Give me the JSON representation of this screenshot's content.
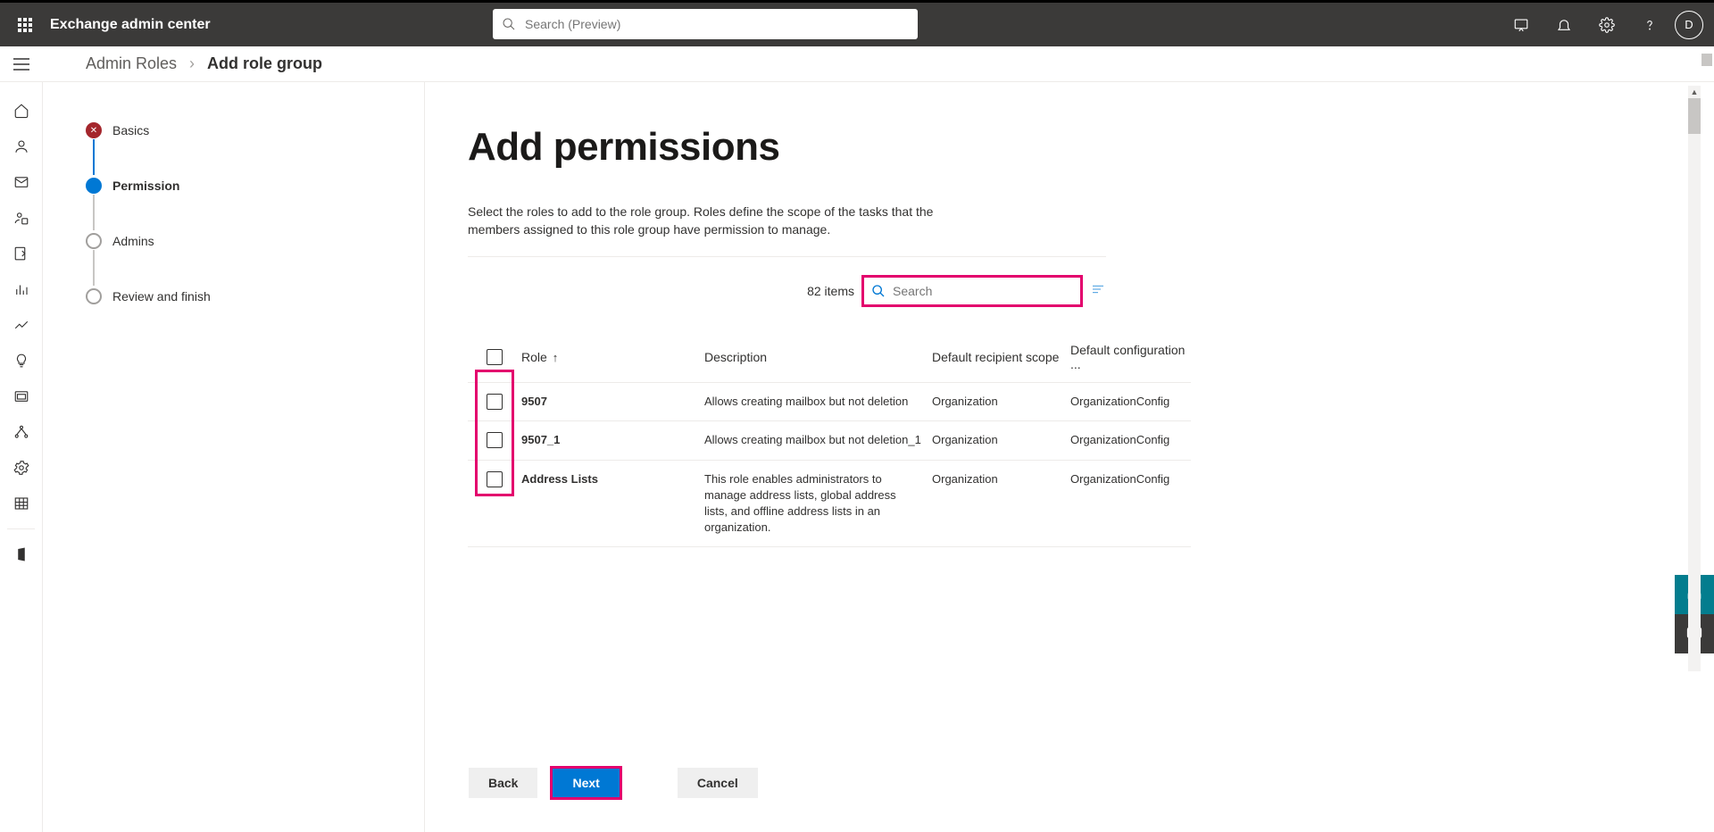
{
  "header": {
    "app_title": "Exchange admin center",
    "search_placeholder": "Search (Preview)",
    "avatar_initial": "D"
  },
  "breadcrumb": {
    "parent": "Admin Roles",
    "current": "Add role group"
  },
  "wizard": {
    "steps": [
      "Basics",
      "Permission",
      "Admins",
      "Review and finish"
    ]
  },
  "main": {
    "title": "Add permissions",
    "description": "Select the roles to add to the role group. Roles define the scope of the tasks that the members assigned to this role group have permission to manage.",
    "item_count": "82 items",
    "search_placeholder": "Search"
  },
  "table": {
    "columns": {
      "role": "Role",
      "description": "Description",
      "scope": "Default recipient scope",
      "config": "Default configuration ..."
    },
    "rows": [
      {
        "role": "9507",
        "description": "Allows creating mailbox but not deletion",
        "scope": "Organization",
        "config": "OrganizationConfig"
      },
      {
        "role": "9507_1",
        "description": "Allows creating mailbox but not deletion_1",
        "scope": "Organization",
        "config": "OrganizationConfig"
      },
      {
        "role": "Address Lists",
        "description": "This role enables administrators to manage address lists, global address lists, and offline address lists in an organization.",
        "scope": "Organization",
        "config": "OrganizationConfig"
      }
    ]
  },
  "buttons": {
    "back": "Back",
    "next": "Next",
    "cancel": "Cancel"
  }
}
